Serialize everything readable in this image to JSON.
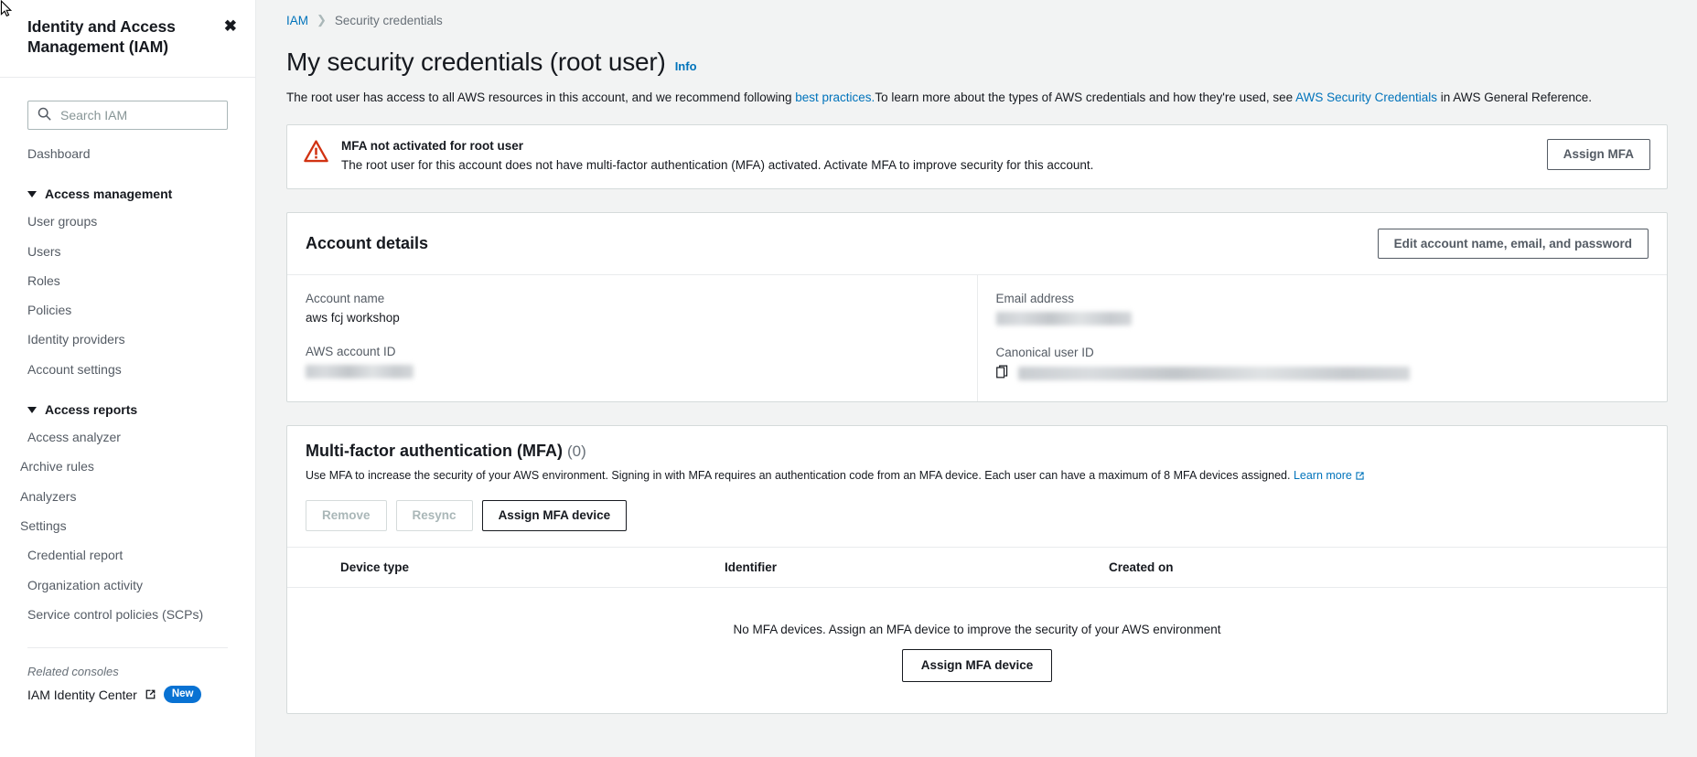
{
  "sidebar": {
    "title": "Identity and Access Management (IAM)",
    "close_label": "✖",
    "search": {
      "placeholder": "Search IAM",
      "value": ""
    },
    "dashboard_label": "Dashboard",
    "groups": [
      {
        "label": "Access management",
        "items": [
          {
            "label": "User groups"
          },
          {
            "label": "Users"
          },
          {
            "label": "Roles"
          },
          {
            "label": "Policies"
          },
          {
            "label": "Identity providers"
          },
          {
            "label": "Account settings"
          }
        ]
      },
      {
        "label": "Access reports",
        "items": [
          {
            "label": "Access analyzer",
            "indent": false
          },
          {
            "label": "Archive rules",
            "indent": true
          },
          {
            "label": "Analyzers",
            "indent": true
          },
          {
            "label": "Settings",
            "indent": true
          },
          {
            "label": "Credential report",
            "indent": false
          },
          {
            "label": "Organization activity",
            "indent": false
          },
          {
            "label": "Service control policies (SCPs)",
            "indent": false
          }
        ]
      }
    ],
    "related": {
      "heading": "Related consoles",
      "link_label": "IAM Identity Center",
      "badge": "New"
    }
  },
  "breadcrumb": {
    "root": "IAM",
    "separator": "❯",
    "current": "Security credentials"
  },
  "page": {
    "title": "My security credentials (root user)",
    "info_label": "Info",
    "description_part1": "The root user has access to all AWS resources in this account, and we recommend following ",
    "description_link1": "best practices.",
    "description_part2": "To learn more about the types of AWS credentials and how they're used, see ",
    "description_link2": "AWS Security Credentials",
    "description_part3": " in AWS General Reference."
  },
  "alert": {
    "icon": "warning-triangle-icon",
    "title": "MFA not activated for root user",
    "body": "The root user for this account does not have multi-factor authentication (MFA) activated. Activate MFA to improve security for this account.",
    "action_label": "Assign MFA",
    "accent_color": "#d13212"
  },
  "account_details": {
    "title": "Account details",
    "edit_label": "Edit account name, email, and password",
    "fields": {
      "account_name_label": "Account name",
      "account_name_value": "aws fcj workshop",
      "aws_account_id_label": "AWS account ID",
      "aws_account_id_value": "",
      "email_label": "Email address",
      "email_value": "",
      "canonical_id_label": "Canonical user ID",
      "canonical_id_value": ""
    }
  },
  "mfa": {
    "title": "Multi-factor authentication (MFA)",
    "count": "(0)",
    "description_part1": "Use MFA to increase the security of your AWS environment. Signing in with MFA requires an authentication code from an MFA device. Each user can have a maximum of 8 MFA devices assigned. ",
    "learn_more_label": "Learn more",
    "buttons": {
      "remove": "Remove",
      "resync": "Resync",
      "assign": "Assign MFA device"
    },
    "columns": [
      "Device type",
      "Identifier",
      "Created on"
    ],
    "empty_text": "No MFA devices. Assign an MFA device to improve the security of your AWS environment",
    "empty_action": "Assign MFA device"
  }
}
